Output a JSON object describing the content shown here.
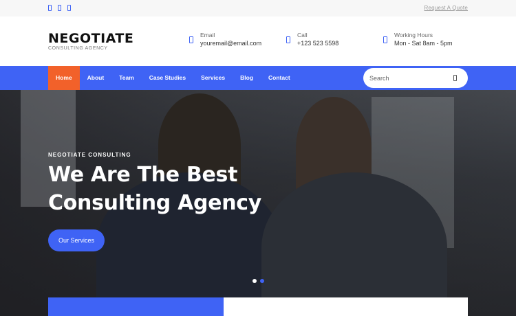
{
  "topbar": {
    "social_icons": [
      "facebook-icon",
      "twitter-icon",
      "instagram-icon"
    ],
    "quote_link": "Request A Quote"
  },
  "brand": {
    "name": "NEGOTIATE",
    "tagline": "CONSULTING AGENCY"
  },
  "contacts": [
    {
      "icon": "email-icon",
      "label": "Email",
      "value": "youremail@email.com"
    },
    {
      "icon": "phone-icon",
      "label": "Call",
      "value": "+123 523 5598"
    },
    {
      "icon": "clock-icon",
      "label": "Working Hours",
      "value": "Mon - Sat 8am - 5pm"
    }
  ],
  "nav": {
    "items": [
      {
        "label": "Home",
        "active": true
      },
      {
        "label": "About",
        "active": false
      },
      {
        "label": "Team",
        "active": false
      },
      {
        "label": "Case Studies",
        "active": false
      },
      {
        "label": "Services",
        "active": false
      },
      {
        "label": "Blog",
        "active": false
      },
      {
        "label": "Contact",
        "active": false
      }
    ],
    "search_placeholder": "Search"
  },
  "hero": {
    "tag": "NEGOTIATE CONSULTING",
    "heading_line1": "We Are The Best",
    "heading_line2": "Consulting Agency",
    "button": "Our Services",
    "slides": 2,
    "active_slide": 2
  },
  "colors": {
    "accent": "#3f63f5",
    "active_nav": "#f2612a"
  }
}
